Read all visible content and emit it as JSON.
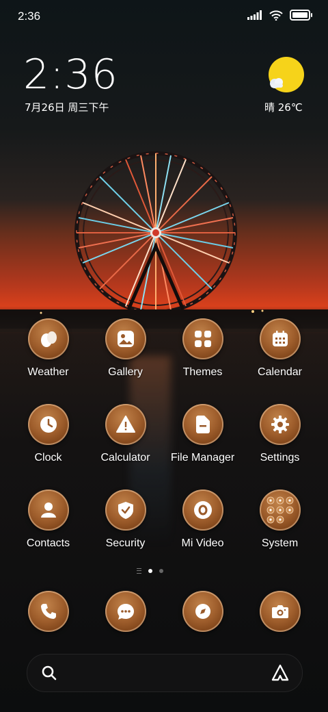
{
  "status_bar": {
    "time": "2:36",
    "icons": [
      "signal-icon",
      "wifi-icon",
      "battery-icon"
    ]
  },
  "clock_widget": {
    "time": "2:36",
    "date": "7月26日 周三下午"
  },
  "weather_widget": {
    "icon": "sunny-icon",
    "text": "晴 26℃"
  },
  "apps": [
    {
      "label": "Weather",
      "icon": "weather-icon"
    },
    {
      "label": "Gallery",
      "icon": "gallery-icon"
    },
    {
      "label": "Themes",
      "icon": "themes-icon"
    },
    {
      "label": "Calendar",
      "icon": "calendar-icon"
    },
    {
      "label": "Clock",
      "icon": "clock-icon"
    },
    {
      "label": "Calculator",
      "icon": "calculator-icon"
    },
    {
      "label": "File Manager",
      "icon": "file-manager-icon"
    },
    {
      "label": "Settings",
      "icon": "settings-icon"
    },
    {
      "label": "Contacts",
      "icon": "contacts-icon"
    },
    {
      "label": "Security",
      "icon": "security-icon"
    },
    {
      "label": "Mi Video",
      "icon": "mi-video-icon"
    },
    {
      "label": "System",
      "icon": "system-folder-icon"
    }
  ],
  "page_indicator": {
    "pages": 2,
    "current": 1
  },
  "dock": [
    {
      "icon": "phone-icon"
    },
    {
      "icon": "messages-icon"
    },
    {
      "icon": "browser-icon"
    },
    {
      "icon": "camera-icon"
    }
  ],
  "search_bar": {
    "left_icon": "search-icon",
    "right_icon": "assistant-icon"
  },
  "colors": {
    "icon_accent": "#a05f2d",
    "sun": "#f6d31a",
    "sunset": "#d8401c"
  }
}
